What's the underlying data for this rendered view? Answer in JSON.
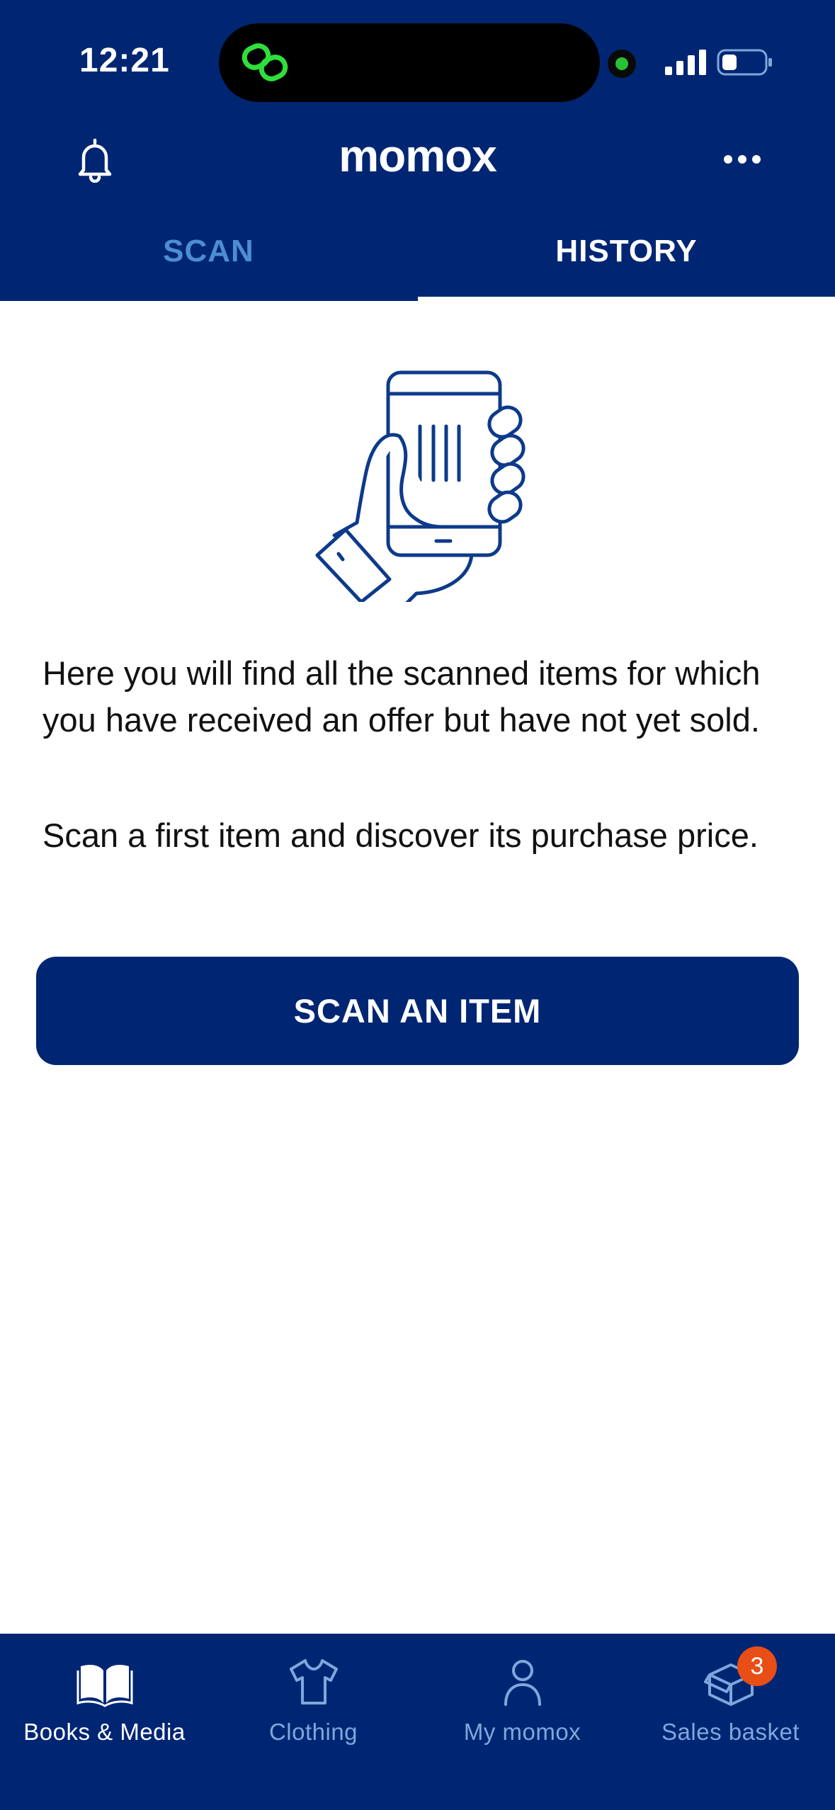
{
  "status_bar": {
    "time": "12:21"
  },
  "app_bar": {
    "brand": "momox"
  },
  "tabs": [
    {
      "label": "SCAN"
    },
    {
      "label": "HISTORY"
    }
  ],
  "content": {
    "paragraph_1": "Here you will find all the scanned items for which you have received an offer but have not yet sold.",
    "paragraph_2": "Scan a first item and discover its purchase price.",
    "scan_button_label": "SCAN AN ITEM"
  },
  "bottom_nav": {
    "items": [
      {
        "label": "Books & Media",
        "icon": "open-book-icon"
      },
      {
        "label": "Clothing",
        "icon": "tshirt-icon"
      },
      {
        "label": "My momox",
        "icon": "user-icon"
      },
      {
        "label": "Sales basket",
        "icon": "box-icon",
        "badge": "3"
      }
    ]
  },
  "colors": {
    "primary": "#002673",
    "tab_inactive": "#4c8ed1",
    "nav_inactive": "#7fa7dc",
    "badge": "#e84e16"
  }
}
